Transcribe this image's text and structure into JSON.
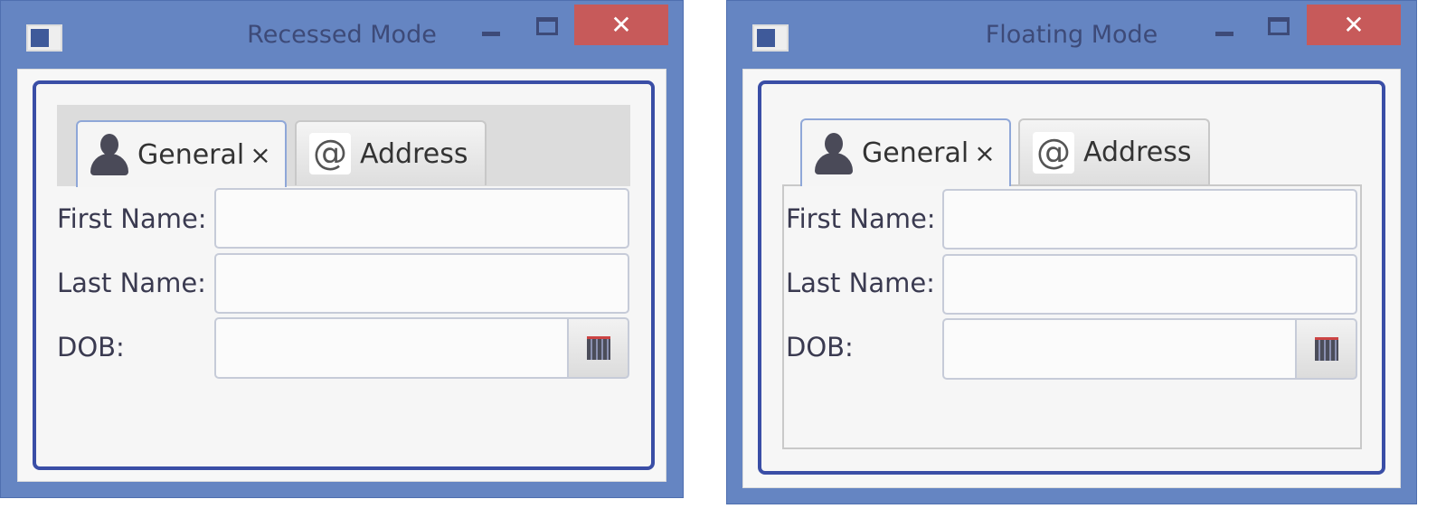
{
  "windows": [
    {
      "title": "Recessed Mode",
      "tabs": [
        {
          "label": "General",
          "icon": "person-icon",
          "closable": true,
          "selected": true
        },
        {
          "label": "Address",
          "icon": "at-sign-icon"
        }
      ],
      "form": {
        "first_name_label": "First Name:",
        "last_name_label": "Last Name:",
        "dob_label": "DOB:",
        "first_name_value": "",
        "last_name_value": "",
        "dob_value": ""
      }
    },
    {
      "title": "Floating Mode",
      "tabs": [
        {
          "label": "General",
          "icon": "person-icon",
          "closable": true,
          "selected": true
        },
        {
          "label": "Address",
          "icon": "at-sign-icon"
        }
      ],
      "form": {
        "first_name_label": "First Name:",
        "last_name_label": "Last Name:",
        "dob_label": "DOB:",
        "first_name_value": "",
        "last_name_value": "",
        "dob_value": ""
      }
    }
  ],
  "controls": {
    "close_glyph": "✕",
    "tab_close_glyph": "×",
    "at_glyph": "@"
  },
  "colors": {
    "titlebar": "#6585c2",
    "close": "#c75a5a",
    "focus_border": "#3a4ea6"
  }
}
